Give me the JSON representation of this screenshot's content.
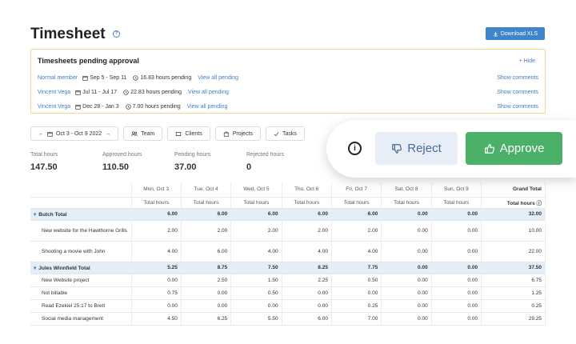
{
  "header": {
    "title": "Timesheet",
    "info_glyph": "?",
    "download_label": "Download XLS"
  },
  "pending": {
    "title": "Timesheets pending approval",
    "hide_label": "+ Hide",
    "rows": [
      {
        "name": "Normal member",
        "dates": "Sep 5 - Sep 11",
        "hours": "16.83 hours pending",
        "view": "View all pending",
        "comments": "Show comments"
      },
      {
        "name": "Vincent Vega",
        "dates": "Jul 11 - Jul 17",
        "hours": "22.83 hours pending",
        "view": "View all pending",
        "comments": "Show comments"
      },
      {
        "name": "Vincent Vega",
        "dates": "Dec 28 - Jan 3",
        "hours": "7.00 hours pending",
        "view": "View all pending",
        "comments": "Show comments"
      }
    ]
  },
  "toolbar": {
    "prev": "←",
    "range": "Oct 3 - Oct 9 2022",
    "next": "→",
    "team": "Team",
    "clients": "Clients",
    "projects": "Projects",
    "tasks": "Tasks"
  },
  "stats": [
    {
      "label": "Total hours",
      "value": "147.50"
    },
    {
      "label": "Approved hours",
      "value": "110.50"
    },
    {
      "label": "Pending hours",
      "value": "37.00"
    },
    {
      "label": "Rejected hours",
      "value": "0"
    }
  ],
  "overlay": {
    "info_glyph": "i",
    "reject_label": "Reject",
    "approve_label": "Approve"
  },
  "table": {
    "days": [
      "Mon, Oct 3",
      "Tue, Oct 4",
      "Wed, Oct 5",
      "Thu, Oct 6",
      "Fri, Oct 7",
      "Sat, Oct 8",
      "Sun, Oct 9"
    ],
    "grand_total": "Grand Total",
    "sub_label": "Total hours",
    "grand_sub_label": "Total hours ⓘ",
    "rows": [
      {
        "type": "group",
        "label": "Butch Total",
        "values": [
          "6.00",
          "6.00",
          "6.00",
          "6.00",
          "6.00",
          "0.00",
          "0.00"
        ],
        "total": "32.00"
      },
      {
        "type": "tall",
        "label": "New website for the Hawthorne Grills",
        "values": [
          "2.00",
          "2.00",
          "2.00",
          "2.00",
          "2.00",
          "0.00",
          "0.00"
        ],
        "total": "10.00"
      },
      {
        "type": "tall",
        "label": "Shooting a movie with John",
        "values": [
          "4.00",
          "6.00",
          "4.00",
          "4.00",
          "4.00",
          "0.00",
          "0.00"
        ],
        "total": "22.00"
      },
      {
        "type": "group",
        "label": "Jules Winnfield Total",
        "values": [
          "5.25",
          "8.75",
          "7.50",
          "8.25",
          "7.75",
          "0.00",
          "0.00"
        ],
        "total": "37.50"
      },
      {
        "type": "item",
        "label": "New Website project",
        "values": [
          "0.00",
          "2.50",
          "1.50",
          "2.25",
          "0.50",
          "0.00",
          "0.00"
        ],
        "total": "6.75"
      },
      {
        "type": "item",
        "label": "Not billable",
        "values": [
          "0.75",
          "0.00",
          "0.50",
          "0.00",
          "0.00",
          "0.00",
          "0.00"
        ],
        "total": "1.25"
      },
      {
        "type": "item",
        "label": "Read Ezekiel 25:17 to Brett",
        "values": [
          "0.00",
          "0.00",
          "0.00",
          "0.00",
          "0.25",
          "0.00",
          "0.00"
        ],
        "total": "0.25"
      },
      {
        "type": "item",
        "label": "Social media management",
        "values": [
          "4.50",
          "6.25",
          "5.50",
          "6.00",
          "7.00",
          "0.00",
          "0.00"
        ],
        "total": "29.25"
      }
    ]
  }
}
